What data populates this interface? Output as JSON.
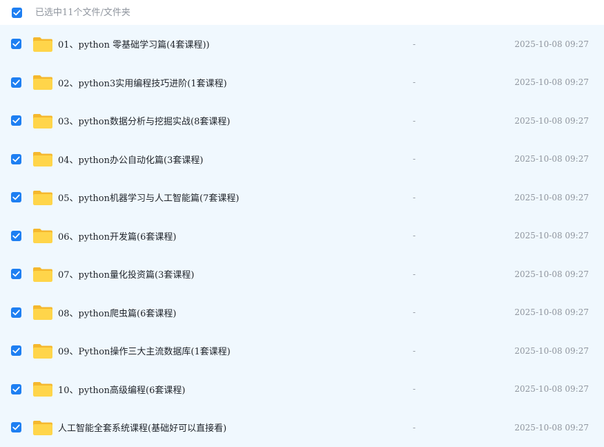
{
  "header": {
    "select_all_checked": true,
    "selection_label": "已选中11个文件/文件夹"
  },
  "colors": {
    "checkbox": "#1e7ff2",
    "list_background": "#f0f8fe",
    "folder_front": "#ffd54a",
    "folder_back": "#f5b82e",
    "muted_text": "#8f959e"
  },
  "icons": {
    "folder": "folder-icon",
    "checkbox": "checkmark-icon"
  },
  "files": [
    {
      "name": "01、python 零基础学习篇(4套课程))",
      "size": "-",
      "date": "2025-10-08 09:27",
      "checked": true
    },
    {
      "name": "02、python3实用编程技巧进阶(1套课程)",
      "size": "-",
      "date": "2025-10-08 09:27",
      "checked": true
    },
    {
      "name": "03、python数据分析与挖掘实战(8套课程)",
      "size": "-",
      "date": "2025-10-08 09:27",
      "checked": true
    },
    {
      "name": "04、python办公自动化篇(3套课程)",
      "size": "-",
      "date": "2025-10-08 09:27",
      "checked": true
    },
    {
      "name": "05、python机器学习与人工智能篇(7套课程)",
      "size": "-",
      "date": "2025-10-08 09:27",
      "checked": true
    },
    {
      "name": "06、python开发篇(6套课程)",
      "size": "-",
      "date": "2025-10-08 09:27",
      "checked": true
    },
    {
      "name": "07、python量化投资篇(3套课程)",
      "size": "-",
      "date": "2025-10-08 09:27",
      "checked": true
    },
    {
      "name": "08、python爬虫篇(6套课程)",
      "size": "-",
      "date": "2025-10-08 09:27",
      "checked": true
    },
    {
      "name": "09、Python操作三大主流数据库(1套课程)",
      "size": "-",
      "date": "2025-10-08 09:27",
      "checked": true
    },
    {
      "name": "10、python高级编程(6套课程)",
      "size": "-",
      "date": "2025-10-08 09:27",
      "checked": true
    },
    {
      "name": "人工智能全套系统课程(基础好可以直接看)",
      "size": "-",
      "date": "2025-10-08 09:27",
      "checked": true
    }
  ]
}
